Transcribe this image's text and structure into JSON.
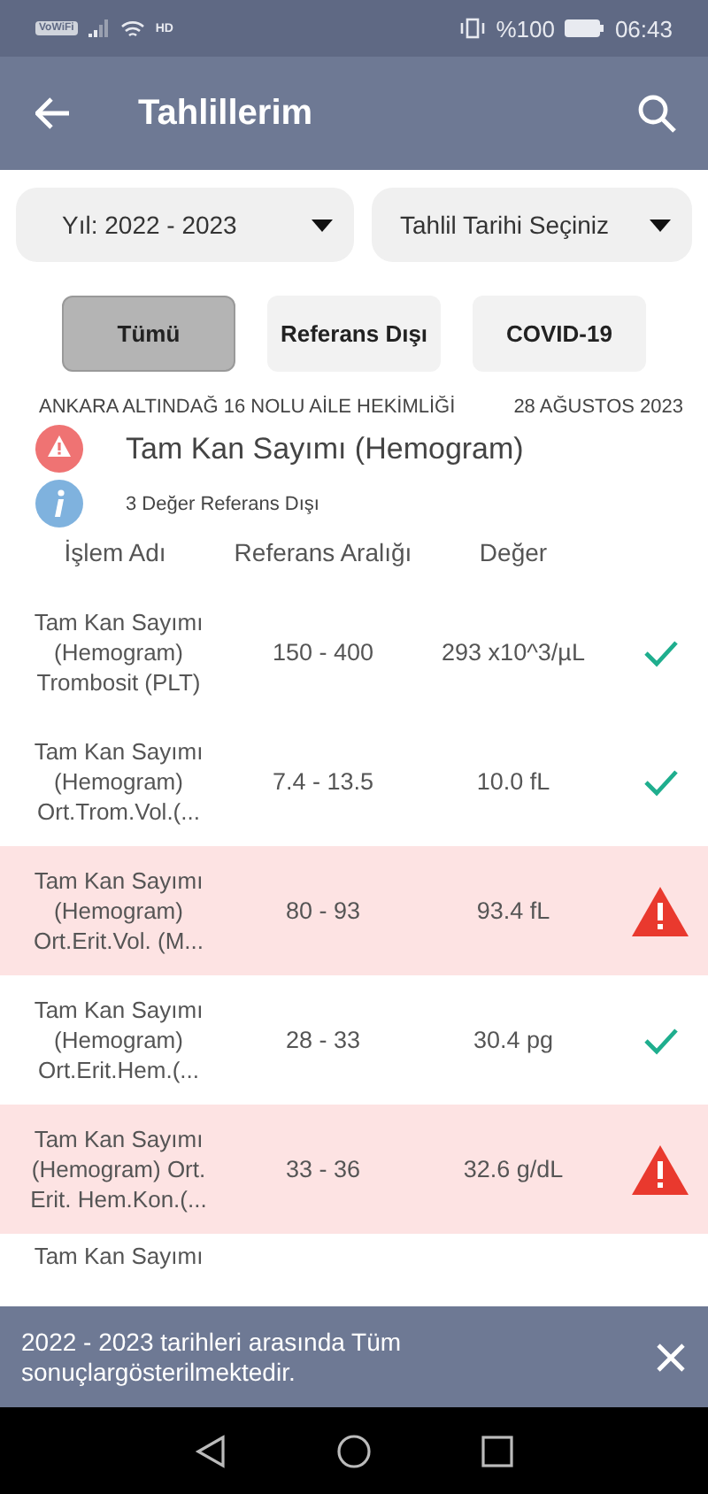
{
  "status_bar": {
    "wifi_badge": "VoWiFi",
    "network": "HD",
    "battery": "%100",
    "time": "06:43"
  },
  "app_bar": {
    "title": "Tahlillerim"
  },
  "dropdowns": [
    {
      "label": "Yıl: 2022 - 2023"
    },
    {
      "label": "Tahlil Tarihi Seçiniz"
    }
  ],
  "filters": [
    {
      "label": "Tümü",
      "selected": true
    },
    {
      "label": "Referans Dışı",
      "selected": false
    },
    {
      "label": "COVID-19",
      "selected": false
    }
  ],
  "result": {
    "facility": "ANKARA ALTINDAĞ 16 NOLU AİLE HEKİMLİĞİ",
    "date": "28 AĞUSTOS 2023",
    "test_name": "Tam Kan Sayımı (Hemogram)",
    "summary": "3 Değer Referans Dışı"
  },
  "table": {
    "columns": [
      "İşlem Adı",
      "Referans Aralığı",
      "Değer"
    ],
    "rows": [
      {
        "name": "Tam Kan Sayımı (Hemogram) Trombosit (PLT)",
        "range": "150 - 400",
        "value": "293 x10^3/µL",
        "out_of_range": false
      },
      {
        "name": "Tam Kan Sayımı (Hemogram) Ort.Trom.Vol.(...",
        "range": "7.4 - 13.5",
        "value": "10.0 fL",
        "out_of_range": false
      },
      {
        "name": "Tam Kan Sayımı (Hemogram) Ort.Erit.Vol. (M...",
        "range": "80 - 93",
        "value": "93.4 fL",
        "out_of_range": true
      },
      {
        "name": "Tam Kan Sayımı (Hemogram) Ort.Erit.Hem.(...",
        "range": "28 - 33",
        "value": "30.4 pg",
        "out_of_range": false
      },
      {
        "name": "Tam Kan Sayımı (Hemogram) Ort. Erit. Hem.Kon.(...",
        "range": "33 - 36",
        "value": "32.6 g/dL",
        "out_of_range": true
      },
      {
        "name": "Tam Kan Sayımı"
      }
    ]
  },
  "snackbar": {
    "message": "2022 - 2023 tarihleri arasında Tüm sonuçlargösterilmektedir."
  }
}
